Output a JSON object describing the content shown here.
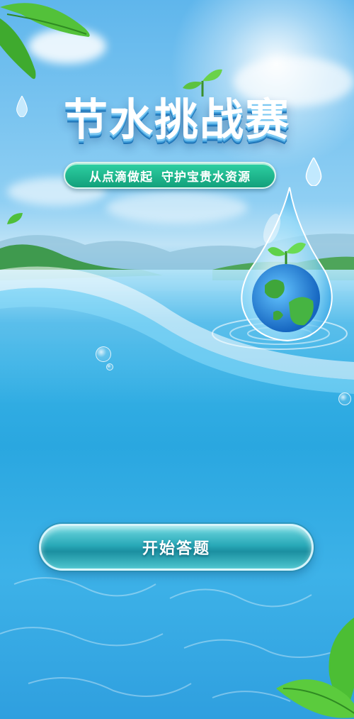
{
  "title": "节水挑战赛",
  "subtitle": {
    "part1": "从点滴做起",
    "part2": "守护宝贵水资源"
  },
  "start_button": {
    "label": "开始答题"
  },
  "colors": {
    "sky": "#5fb6ec",
    "water": "#2aa7e0",
    "pill": "#12a07b",
    "button": "#29a9b8",
    "leaf": "#3fb53a"
  },
  "icons": [
    "leaf-icon",
    "water-drop-icon",
    "globe-icon",
    "sprout-icon",
    "bubble-icon"
  ]
}
